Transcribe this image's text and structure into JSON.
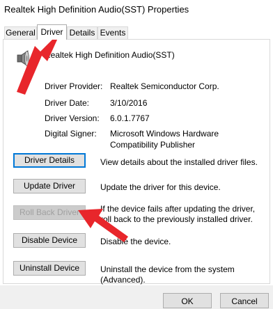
{
  "window": {
    "title": "Realtek High Definition Audio(SST) Properties"
  },
  "tabs": [
    {
      "label": "General"
    },
    {
      "label": "Driver"
    },
    {
      "label": "Details"
    },
    {
      "label": "Events"
    }
  ],
  "device": {
    "name": "Realtek High Definition Audio(SST)",
    "icon": "speaker-icon"
  },
  "info": [
    {
      "label": "Driver Provider:",
      "value": "Realtek Semiconductor Corp."
    },
    {
      "label": "Driver Date:",
      "value": "3/10/2016"
    },
    {
      "label": "Driver Version:",
      "value": "6.0.1.7767"
    },
    {
      "label": "Digital Signer:",
      "value": "Microsoft Windows Hardware Compatibility Publisher"
    }
  ],
  "actions": [
    {
      "label": "Driver Details",
      "desc": "View details about the installed driver files."
    },
    {
      "label": "Update Driver",
      "desc": "Update the driver for this device."
    },
    {
      "label": "Roll Back Driver",
      "desc": "If the device fails after updating the driver, roll back to the previously installed driver."
    },
    {
      "label": "Disable Device",
      "desc": "Disable the device."
    },
    {
      "label": "Uninstall Device",
      "desc": "Uninstall the device from the system (Advanced)."
    }
  ],
  "footer": {
    "ok": "OK",
    "cancel": "Cancel"
  },
  "colors": {
    "accent": "#0078d7",
    "annotation": "#e8262b"
  }
}
